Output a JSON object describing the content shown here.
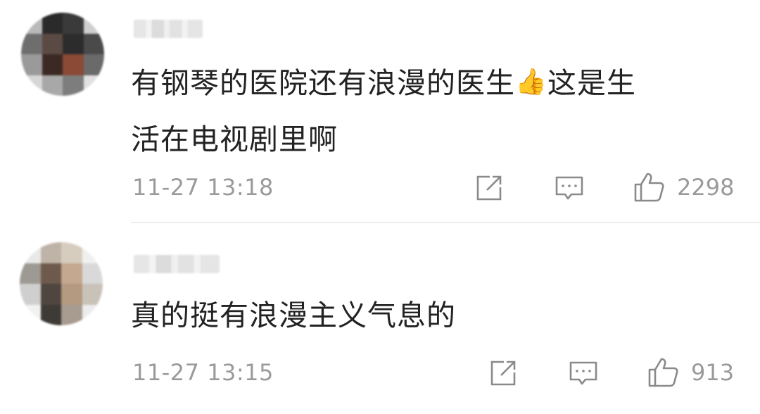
{
  "comments": [
    {
      "text": "有钢琴的医院还有浪漫的医生",
      "emoji": "👍",
      "text_after": "这是生",
      "text_line2": "活在电视剧里啊",
      "time": "11-27 13:18",
      "likes": "2298"
    },
    {
      "text": "真的挺有浪漫主义气息的",
      "time": "11-27 13:15",
      "likes": "913"
    }
  ],
  "icons": {
    "share": "share-icon",
    "reply": "comment-icon",
    "like": "thumbs-up-icon"
  },
  "colors": {
    "text": "#222222",
    "meta": "#9a9a9a",
    "divider": "#eeeeee"
  }
}
